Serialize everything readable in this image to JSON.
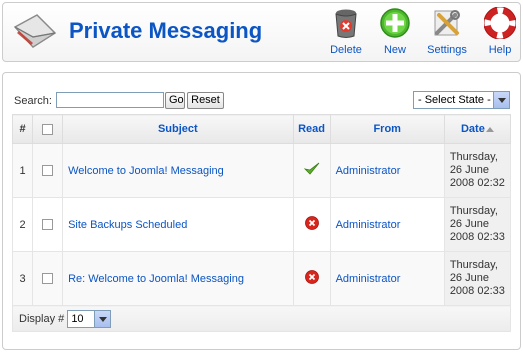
{
  "header": {
    "title": "Private Messaging",
    "toolbar": {
      "delete_label": "Delete",
      "new_label": "New",
      "settings_label": "Settings",
      "help_label": "Help"
    }
  },
  "filters": {
    "search_label": "Search:",
    "search_value": "",
    "go_label": "Go",
    "reset_label": "Reset",
    "state_select": "- Select State -"
  },
  "table": {
    "columns": {
      "num": "#",
      "subject": "Subject",
      "read": "Read",
      "from": "From",
      "date": "Date"
    },
    "rows": [
      {
        "num": "1",
        "subject": "Welcome to Joomla! Messaging",
        "read": "yes",
        "from": "Administrator",
        "date": "Thursday, 26 June 2008 02:32"
      },
      {
        "num": "2",
        "subject": "Site Backups Scheduled",
        "read": "no",
        "from": "Administrator",
        "date": "Thursday, 26 June 2008 02:33"
      },
      {
        "num": "3",
        "subject": "Re: Welcome to Joomla! Messaging",
        "read": "no",
        "from": "Administrator",
        "date": "Thursday, 26 June 2008 02:33"
      }
    ]
  },
  "footer": {
    "display_label": "Display #",
    "limit_value": "10"
  },
  "icons": {
    "read": "checkmark-icon",
    "unread": "red-x-icon"
  },
  "colors": {
    "accent": "#0b55c4"
  }
}
